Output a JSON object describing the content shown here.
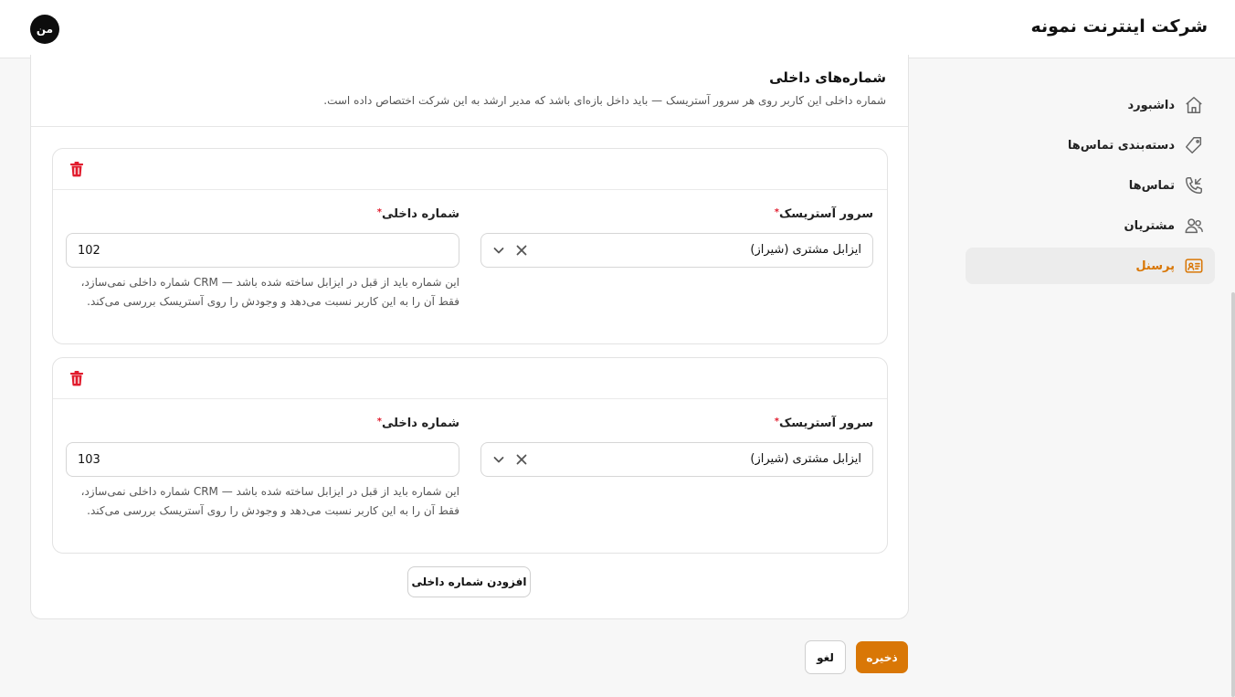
{
  "header": {
    "company_name": "شرکت اینترنت نمونه",
    "avatar_initials": "من"
  },
  "sidebar": {
    "items": [
      {
        "label": "داشبورد",
        "icon": "home-icon",
        "active": false
      },
      {
        "label": "دسته‌بندی تماس‌ها",
        "icon": "tag-icon",
        "active": false
      },
      {
        "label": "تماس‌ها",
        "icon": "phone-incoming-icon",
        "active": false
      },
      {
        "label": "مشتریان",
        "icon": "users-icon",
        "active": false
      },
      {
        "label": "پرسنل",
        "icon": "id-card-icon",
        "active": true
      }
    ]
  },
  "section": {
    "title": "شماره‌های داخلی",
    "description": "شماره داخلی این کاربر روی هر سرور آستریسک — باید داخل بازه‌ای باشد که مدیر ارشد به این شرکت اختصاص داده است."
  },
  "extensions": [
    {
      "server_label": "سرور آستریسک",
      "server_value": "ایزابل مشتری (شیراز)",
      "ext_label": "شماره داخلی",
      "ext_value": "102",
      "hint": "این شماره باید از قبل در ایزابل ساخته شده باشد — CRM شماره داخلی نمی‌سازد، فقط آن را به این کاربر نسبت می‌دهد و وجودش را روی آستریسک بررسی می‌کند."
    },
    {
      "server_label": "سرور آستریسک",
      "server_value": "ایزابل مشتری (شیراز)",
      "ext_label": "شماره داخلی",
      "ext_value": "103",
      "hint": "این شماره باید از قبل در ایزابل ساخته شده باشد — CRM شماره داخلی نمی‌سازد، فقط آن را به این کاربر نسبت می‌دهد و وجودش را روی آستریسک بررسی می‌کند."
    }
  ],
  "required_mark": "*",
  "actions": {
    "add_label": "افزودن شماره داخلی",
    "save_label": "ذخیره",
    "cancel_label": "لغو"
  },
  "colors": {
    "accent": "#d97706",
    "danger": "#e11d2e"
  }
}
